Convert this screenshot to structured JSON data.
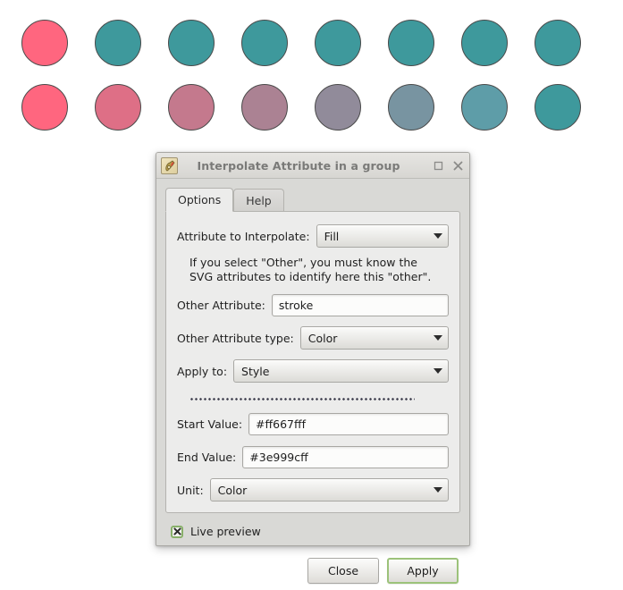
{
  "artboard": {
    "label": "svg-canvas",
    "stroke_color": "#4a4a4a",
    "rows": [
      {
        "name": "row-original",
        "colors": [
          "#ff667f",
          "#3e999c",
          "#3e999c",
          "#3e999c",
          "#3e999c",
          "#3e999c",
          "#3e999c",
          "#3e999c"
        ]
      },
      {
        "name": "row-interpolated",
        "colors": [
          "#ff667f",
          "#de6f86",
          "#c4798d",
          "#ab8293",
          "#918b9a",
          "#7894a1",
          "#5e9da8",
          "#3e999c"
        ]
      }
    ]
  },
  "dialog": {
    "title": "Interpolate Attribute in a group",
    "icon": "inkscape-extension-icon",
    "window_controls": {
      "maximize": "maximize-icon",
      "close": "close-icon"
    },
    "tabs": [
      {
        "label": "Options",
        "active": true
      },
      {
        "label": "Help",
        "active": false
      }
    ],
    "fields": {
      "attribute_to_interpolate": {
        "label": "Attribute to Interpolate:",
        "value": "Fill",
        "type": "combo"
      },
      "hint": {
        "line1": "If you select \"Other\", you must know the",
        "line2": "SVG attributes to identify here this \"other\"."
      },
      "other_attribute": {
        "label": "Other Attribute:",
        "value": "stroke",
        "type": "entry"
      },
      "other_attribute_type": {
        "label": "Other Attribute type:",
        "value": "Color",
        "type": "combo"
      },
      "apply_to": {
        "label": "Apply to:",
        "value": "Style",
        "type": "combo"
      },
      "start_value": {
        "label": "Start Value:",
        "value": "#ff667fff",
        "type": "entry"
      },
      "end_value": {
        "label": "End Value:",
        "value": "#3e999cff",
        "type": "entry"
      },
      "unit": {
        "label": "Unit:",
        "value": "Color",
        "type": "combo"
      }
    },
    "live_preview": {
      "label": "Live preview",
      "checked": true,
      "accent_color": "#88b06a"
    },
    "buttons": {
      "close": "Close",
      "apply": "Apply"
    }
  }
}
